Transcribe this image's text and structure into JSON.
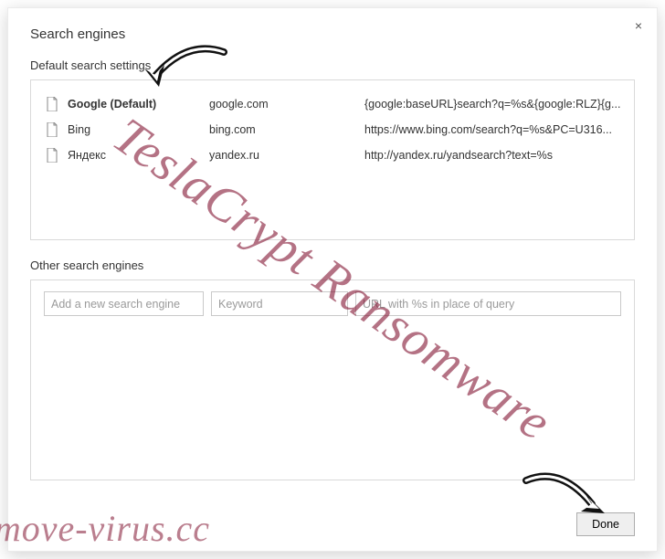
{
  "dialog": {
    "title": "Search engines",
    "close_label": "×"
  },
  "defaults": {
    "section_label": "Default search settings",
    "engines": [
      {
        "name": "Google (Default)",
        "keyword": "google.com",
        "url": "{google:baseURL}search?q=%s&{google:RLZ}{g...",
        "bold": true
      },
      {
        "name": "Bing",
        "keyword": "bing.com",
        "url": "https://www.bing.com/search?q=%s&PC=U316..."
      },
      {
        "name": "Яндекс",
        "keyword": "yandex.ru",
        "url": "http://yandex.ru/yandsearch?text=%s"
      }
    ]
  },
  "others": {
    "section_label": "Other search engines",
    "name_placeholder": "Add a new search engine",
    "keyword_placeholder": "Keyword",
    "url_placeholder": "URL with %s in place of query"
  },
  "footer": {
    "done_label": "Done"
  },
  "watermark": {
    "main": "TeslaCrypt Ransomware",
    "bottom": "remove-virus.cc"
  }
}
